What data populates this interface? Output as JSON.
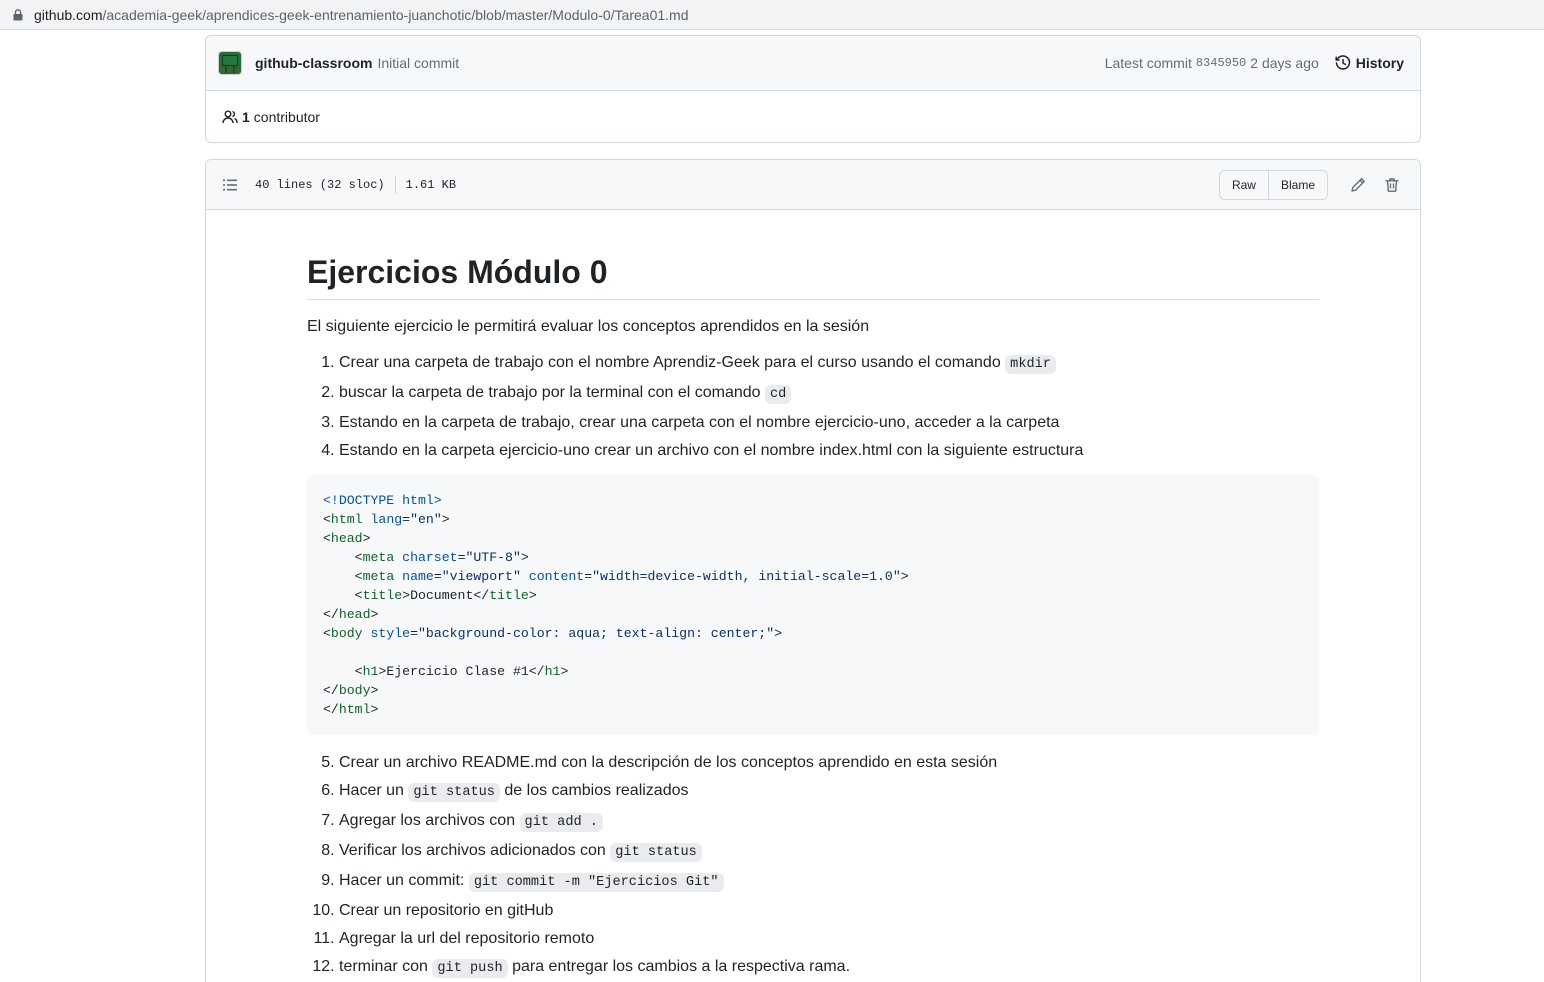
{
  "browser": {
    "url_host": "github.com",
    "url_path": "/academia-geek/aprendices-geek-entrenamiento-juanchotic/blob/master/Modulo-0/Tarea01.md"
  },
  "commit": {
    "author": "github-classroom",
    "message": "Initial commit",
    "latest_label": "Latest commit",
    "sha": "8345950",
    "ago": "2 days ago",
    "history_label": "History",
    "contributors_count": "1",
    "contributors_label": "contributor"
  },
  "file": {
    "lines": "40 lines (32 sloc)",
    "size": "1.61 KB",
    "raw_label": "Raw",
    "blame_label": "Blame"
  },
  "markdown": {
    "title": "Ejercicios Módulo 0",
    "intro": "El siguiente ejercicio le permitirá evaluar los conceptos aprendidos en la sesión",
    "steps_before": [
      {
        "text": "Crear una carpeta de trabajo con el nombre Aprendiz-Geek para el curso usando el comando ",
        "code": "mkdir",
        "after": ""
      },
      {
        "text": "buscar la carpeta de trabajo por la terminal con el comando ",
        "code": "cd",
        "after": ""
      },
      {
        "text": "Estando en la carpeta de trabajo, crear una carpeta con el nombre ejercicio-uno, acceder a la carpeta",
        "code": "",
        "after": ""
      },
      {
        "text": "Estando en la carpeta ejercicio-uno crear un archivo con el nombre index.html con la siguiente estructura",
        "code": "",
        "after": ""
      }
    ],
    "code_lines": [
      [
        {
          "t": "doctype",
          "v": "<!DOCTYPE html>"
        }
      ],
      [
        {
          "t": "p",
          "v": "<"
        },
        {
          "t": "tag",
          "v": "html"
        },
        {
          "t": "p",
          "v": " "
        },
        {
          "t": "attr",
          "v": "lang"
        },
        {
          "t": "p",
          "v": "="
        },
        {
          "t": "str",
          "v": "\"en\""
        },
        {
          "t": "p",
          "v": ">"
        }
      ],
      [
        {
          "t": "p",
          "v": "<"
        },
        {
          "t": "tag",
          "v": "head"
        },
        {
          "t": "p",
          "v": ">"
        }
      ],
      [
        {
          "t": "p",
          "v": "    <"
        },
        {
          "t": "tag",
          "v": "meta"
        },
        {
          "t": "p",
          "v": " "
        },
        {
          "t": "attr",
          "v": "charset"
        },
        {
          "t": "p",
          "v": "="
        },
        {
          "t": "str",
          "v": "\"UTF-8\""
        },
        {
          "t": "p",
          "v": ">"
        }
      ],
      [
        {
          "t": "p",
          "v": "    <"
        },
        {
          "t": "tag",
          "v": "meta"
        },
        {
          "t": "p",
          "v": " "
        },
        {
          "t": "attr",
          "v": "name"
        },
        {
          "t": "p",
          "v": "="
        },
        {
          "t": "str",
          "v": "\"viewport\""
        },
        {
          "t": "p",
          "v": " "
        },
        {
          "t": "attr",
          "v": "content"
        },
        {
          "t": "p",
          "v": "="
        },
        {
          "t": "str",
          "v": "\"width=device-width, initial-scale=1.0\""
        },
        {
          "t": "p",
          "v": ">"
        }
      ],
      [
        {
          "t": "p",
          "v": "    <"
        },
        {
          "t": "tag",
          "v": "title"
        },
        {
          "t": "p",
          "v": ">Document</"
        },
        {
          "t": "tag",
          "v": "title"
        },
        {
          "t": "p",
          "v": ">"
        }
      ],
      [
        {
          "t": "p",
          "v": "</"
        },
        {
          "t": "tag",
          "v": "head"
        },
        {
          "t": "p",
          "v": ">"
        }
      ],
      [
        {
          "t": "p",
          "v": "<"
        },
        {
          "t": "tag",
          "v": "body"
        },
        {
          "t": "p",
          "v": " "
        },
        {
          "t": "attr",
          "v": "style"
        },
        {
          "t": "p",
          "v": "="
        },
        {
          "t": "str",
          "v": "\"background-color: aqua; text-align: center;\""
        },
        {
          "t": "p",
          "v": ">"
        }
      ],
      [],
      [
        {
          "t": "p",
          "v": "    <"
        },
        {
          "t": "tag",
          "v": "h1"
        },
        {
          "t": "p",
          "v": ">Ejercicio Clase #1</"
        },
        {
          "t": "tag",
          "v": "h1"
        },
        {
          "t": "p",
          "v": ">"
        }
      ],
      [
        {
          "t": "p",
          "v": "</"
        },
        {
          "t": "tag",
          "v": "body"
        },
        {
          "t": "p",
          "v": ">"
        }
      ],
      [
        {
          "t": "p",
          "v": "</"
        },
        {
          "t": "tag",
          "v": "html"
        },
        {
          "t": "p",
          "v": ">"
        }
      ]
    ],
    "steps_after_start": 5,
    "steps_after": [
      {
        "text": "Crear un archivo README.md con la descripción de los conceptos aprendido en esta sesión",
        "code": "",
        "after": ""
      },
      {
        "text": "Hacer un ",
        "code": "git status",
        "after": " de los cambios realizados"
      },
      {
        "text": "Agregar los archivos con ",
        "code": "git add .",
        "after": ""
      },
      {
        "text": "Verificar los archivos adicionados con ",
        "code": "git status",
        "after": ""
      },
      {
        "text": "Hacer un commit: ",
        "code": "git commit -m \"Ejercicios Git\"",
        "after": ""
      },
      {
        "text": "Crear un repositorio en gitHub",
        "code": "",
        "after": ""
      },
      {
        "text": "Agregar la url del repositorio remoto",
        "code": "",
        "after": ""
      },
      {
        "text": "terminar con ",
        "code": "git push",
        "after": " para entregar los cambios a la respectiva rama."
      }
    ]
  },
  "icons": {
    "lock": "lock-icon",
    "history": "history-clock-icon",
    "people": "people-icon",
    "toc": "list-unordered-icon",
    "edit": "pencil-icon",
    "delete": "trash-icon"
  }
}
